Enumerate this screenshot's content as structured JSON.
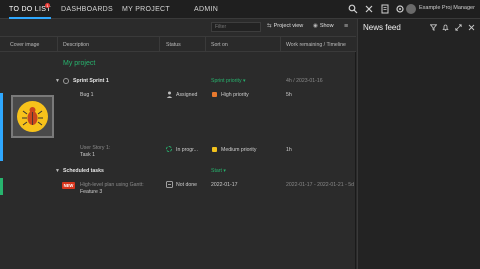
{
  "nav": {
    "tabs": [
      {
        "label": "TO DO LIST",
        "active": true
      },
      {
        "label": "DASHBOARDS"
      },
      {
        "label": "MY PROJECT"
      },
      {
        "label": "ADMIN"
      }
    ],
    "todo_badge": "1",
    "user": {
      "name": "Example Proj Manager"
    },
    "icons": [
      "search-icon",
      "tools-icon",
      "notes-icon",
      "settings-icon"
    ]
  },
  "toolbar": {
    "filter_placeholder": "Filter",
    "project_view": "Project view",
    "show": "Show"
  },
  "columns": [
    "Cover image",
    "Description",
    "Status",
    "Sort on",
    "Work remaining / Timeline"
  ],
  "project": {
    "title": "My project"
  },
  "groups": [
    {
      "name": "Sprint Sprint 1",
      "sort": "Sprint priority ▾",
      "timeline": "4h / 2023-01-16",
      "items": [
        {
          "desc": "Bug 1",
          "status": "Assigned",
          "priority": "High priority",
          "priority_color": "#e8792e",
          "work": "5h"
        },
        {
          "desc_line1": "User Story 1:",
          "desc_line2": "Task 1",
          "status": "In progr...",
          "priority": "Medium priority",
          "priority_color": "#f2c21d",
          "work": "1h"
        }
      ]
    },
    {
      "name": "Scheduled tasks",
      "sort": "Start ▾",
      "items": [
        {
          "tag": "NEW",
          "desc_line1": "High-level plan using Gantt:",
          "desc_line2": "Feature 3",
          "status": "Not done",
          "date": "2022-01-17",
          "timeline": "2022-01-17 - 2022-01-21 - 5d"
        }
      ]
    }
  ],
  "feed": {
    "title": "News feed"
  },
  "colors": {
    "accent_blue": "#2fa8ff",
    "green": "#27b46e",
    "badge_red": "#e53935"
  }
}
